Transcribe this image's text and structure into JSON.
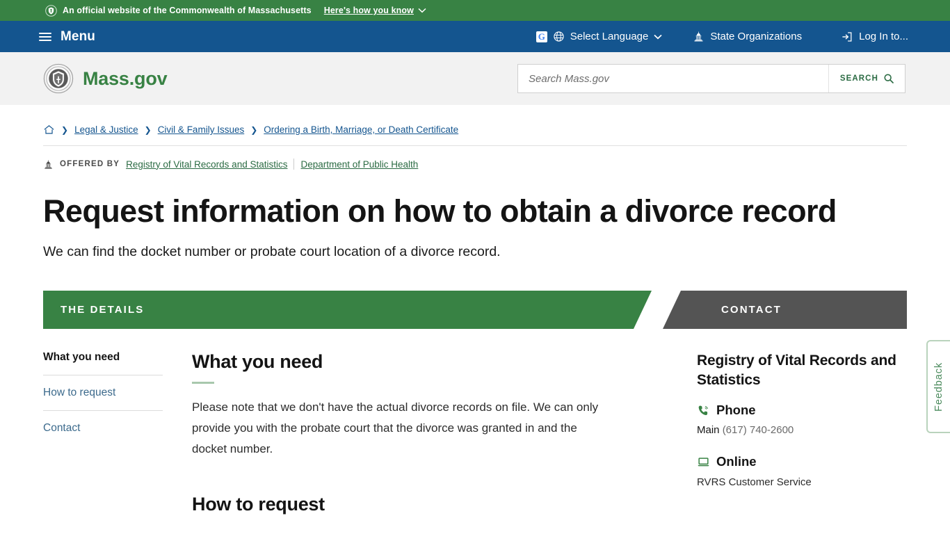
{
  "official_banner": {
    "text": "An official website of the Commonwealth of Massachusetts",
    "link": "Here's how you know",
    "icon": "shield-icon",
    "bg_color": "#388244"
  },
  "utility_nav": {
    "menu_label": "Menu",
    "bg_color": "#14558f",
    "items": [
      {
        "label": "Select Language",
        "icon": "globe-icon",
        "has_caret": true
      },
      {
        "label": "State Organizations",
        "icon": "capitol-icon",
        "has_caret": false
      },
      {
        "label": "Log In to...",
        "icon": "login-icon",
        "has_caret": false
      }
    ]
  },
  "header": {
    "brand": "Mass.gov",
    "brand_color": "#388244",
    "seal_icon": "massachusetts-seal-icon",
    "search": {
      "placeholder": "Search Mass.gov",
      "value": "",
      "button_label": "SEARCH",
      "button_icon": "search-icon"
    }
  },
  "breadcrumb": {
    "home_icon": "home-icon",
    "items": [
      "Legal & Justice",
      "Civil & Family Issues",
      "Ordering a Birth, Marriage, or Death Certificate"
    ]
  },
  "offered_by": {
    "icon": "capitol-icon",
    "label": "OFFERED BY",
    "orgs": [
      "Registry of Vital Records and Statistics",
      "Department of Public Health"
    ]
  },
  "page": {
    "title": "Request information on how to obtain a divorce record",
    "subtitle": "We can find the docket number or probate court location of a divorce record."
  },
  "tabs": [
    {
      "label": "THE DETAILS",
      "active": true,
      "color": "#388244"
    },
    {
      "label": "CONTACT",
      "active": false,
      "color": "#545454"
    }
  ],
  "sidenav": {
    "items": [
      {
        "label": "What you need",
        "active": true
      },
      {
        "label": "How to request",
        "active": false
      },
      {
        "label": "Contact",
        "active": false
      }
    ]
  },
  "main": {
    "section_heading": "What you need",
    "paragraph": "Please note that we don't have the actual divorce records on file. We can only provide you with the probate court that the divorce was granted in and the docket number.",
    "next_heading": "How to request"
  },
  "contact": {
    "org": "Registry of Vital Records and Statistics",
    "phone": {
      "icon": "phone-icon",
      "heading": "Phone",
      "label": "Main",
      "number": "(617) 740-2600"
    },
    "online": {
      "icon": "laptop-icon",
      "heading": "Online",
      "link": "RVRS Customer Service"
    }
  },
  "feedback": {
    "label": "Feedback",
    "color": "#4a8a5c"
  }
}
